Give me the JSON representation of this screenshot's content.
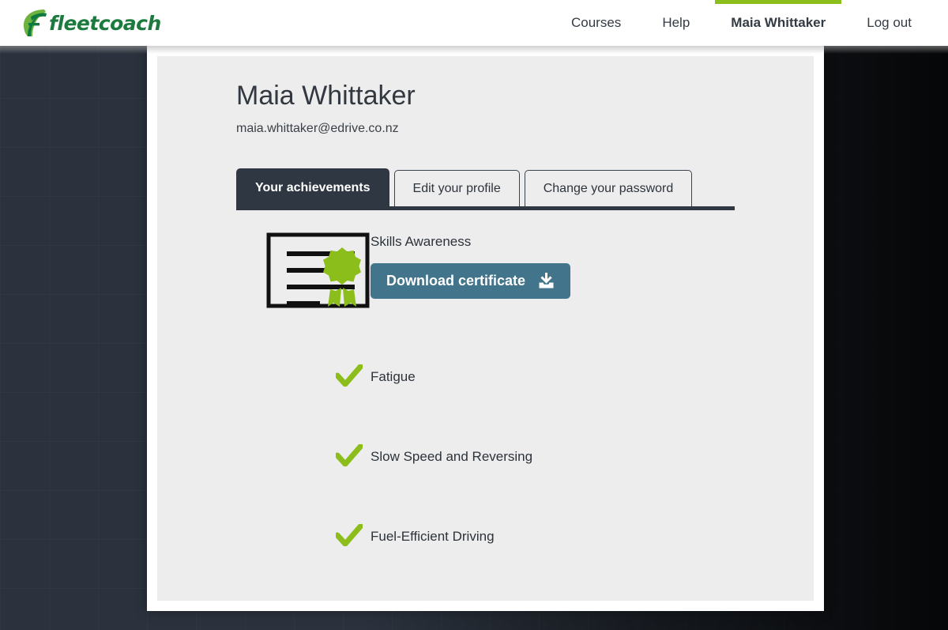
{
  "brand": {
    "wordmark": "fleetcoach",
    "mark_icon": "leaf-f-logo-icon",
    "leaf_light_color": "#6cb33f",
    "leaf_dark_color": "#0f7a3d",
    "wordmark_color": "#1c7a3e"
  },
  "nav": {
    "items": [
      {
        "label": "Courses",
        "active": false
      },
      {
        "label": "Help",
        "active": false
      },
      {
        "label": "Maia Whittaker",
        "active": true
      },
      {
        "label": "Log out",
        "active": false
      }
    ],
    "active_indicator_color": "#8cbe1b"
  },
  "profile": {
    "name": "Maia Whittaker",
    "email": "maia.whittaker@edrive.co.nz"
  },
  "tabs": [
    {
      "label": "Your achievements",
      "active": true
    },
    {
      "label": "Edit your profile",
      "active": false
    },
    {
      "label": "Change your password",
      "active": false
    }
  ],
  "achievements": [
    {
      "title": "Skills Awareness",
      "icon": "certificate-icon",
      "has_certificate": true,
      "button_label": "Download certificate",
      "button_icon": "download-icon",
      "button_color": "#42748b"
    },
    {
      "title": "Fatigue",
      "icon": "green-check-icon",
      "has_certificate": false
    },
    {
      "title": "Slow Speed and Reversing",
      "icon": "green-check-icon",
      "has_certificate": false
    },
    {
      "title": "Fuel-Efficient Driving",
      "icon": "green-check-icon",
      "has_certificate": false
    }
  ],
  "colors": {
    "page_background": "#2b323d",
    "card_background": "#ededed",
    "accent_green": "#8cbe1b",
    "dark_tab": "#2f3742",
    "text_dark": "#2d333a"
  }
}
